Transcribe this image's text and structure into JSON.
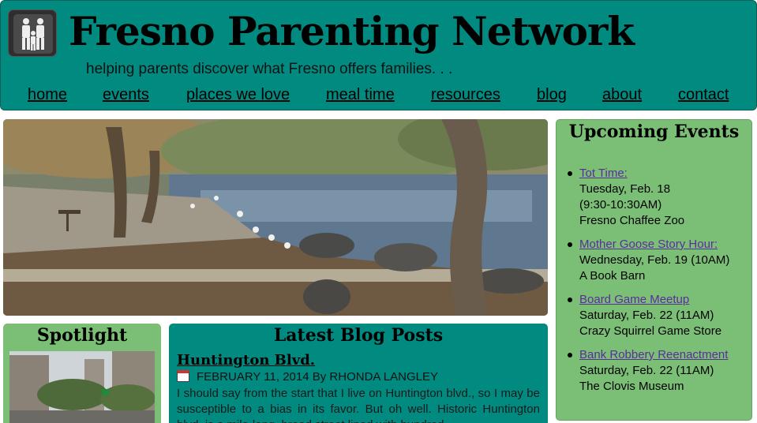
{
  "site": {
    "title": "Fresno Parenting Network",
    "tagline": "helping parents discover what Fresno offers families. . ."
  },
  "nav": {
    "items": [
      "home",
      "events",
      "places we love",
      "meal time",
      "resources",
      "blog",
      "about",
      "contact"
    ]
  },
  "events": {
    "title": "Upcoming Events",
    "items": [
      {
        "name": "Tot Time:",
        "date": "Tuesday, Feb. 18",
        "time": "(9:30-10:30AM)",
        "location": "Fresno Chaffee Zoo"
      },
      {
        "name": "Mother Goose Story Hour:",
        "date": "Wednesday, Feb. 19 (10AM)",
        "location": "A Book Barn"
      },
      {
        "name": "Board Game Meetup",
        "date": "Saturday, Feb. 22 (11AM)",
        "location": "Crazy Squirrel Game Store"
      },
      {
        "name": "Bank Robbery Reenactment",
        "date": "Saturday, Feb. 22 (11AM)",
        "location": "The Clovis Museum"
      }
    ]
  },
  "spotlight": {
    "title": "Spotlight"
  },
  "blog": {
    "title": "Latest Blog Posts",
    "post": {
      "title": "Huntington Blvd.",
      "meta": "FEBRUARY 11, 2014 By RHONDA LANGLEY",
      "excerpt": "I should say from the start that I live on Huntington blvd., so I may be susceptible to a bias in its favor. But oh well. Historic Huntington blvd. is a mile-long, broad street lined with hundred"
    }
  },
  "icons": {
    "logo": "family-icon",
    "post_meta": "calendar-icon"
  },
  "colors": {
    "header": "#008a80",
    "panel_green": "#7bbf76",
    "link_purple": "#5a2d9a"
  }
}
